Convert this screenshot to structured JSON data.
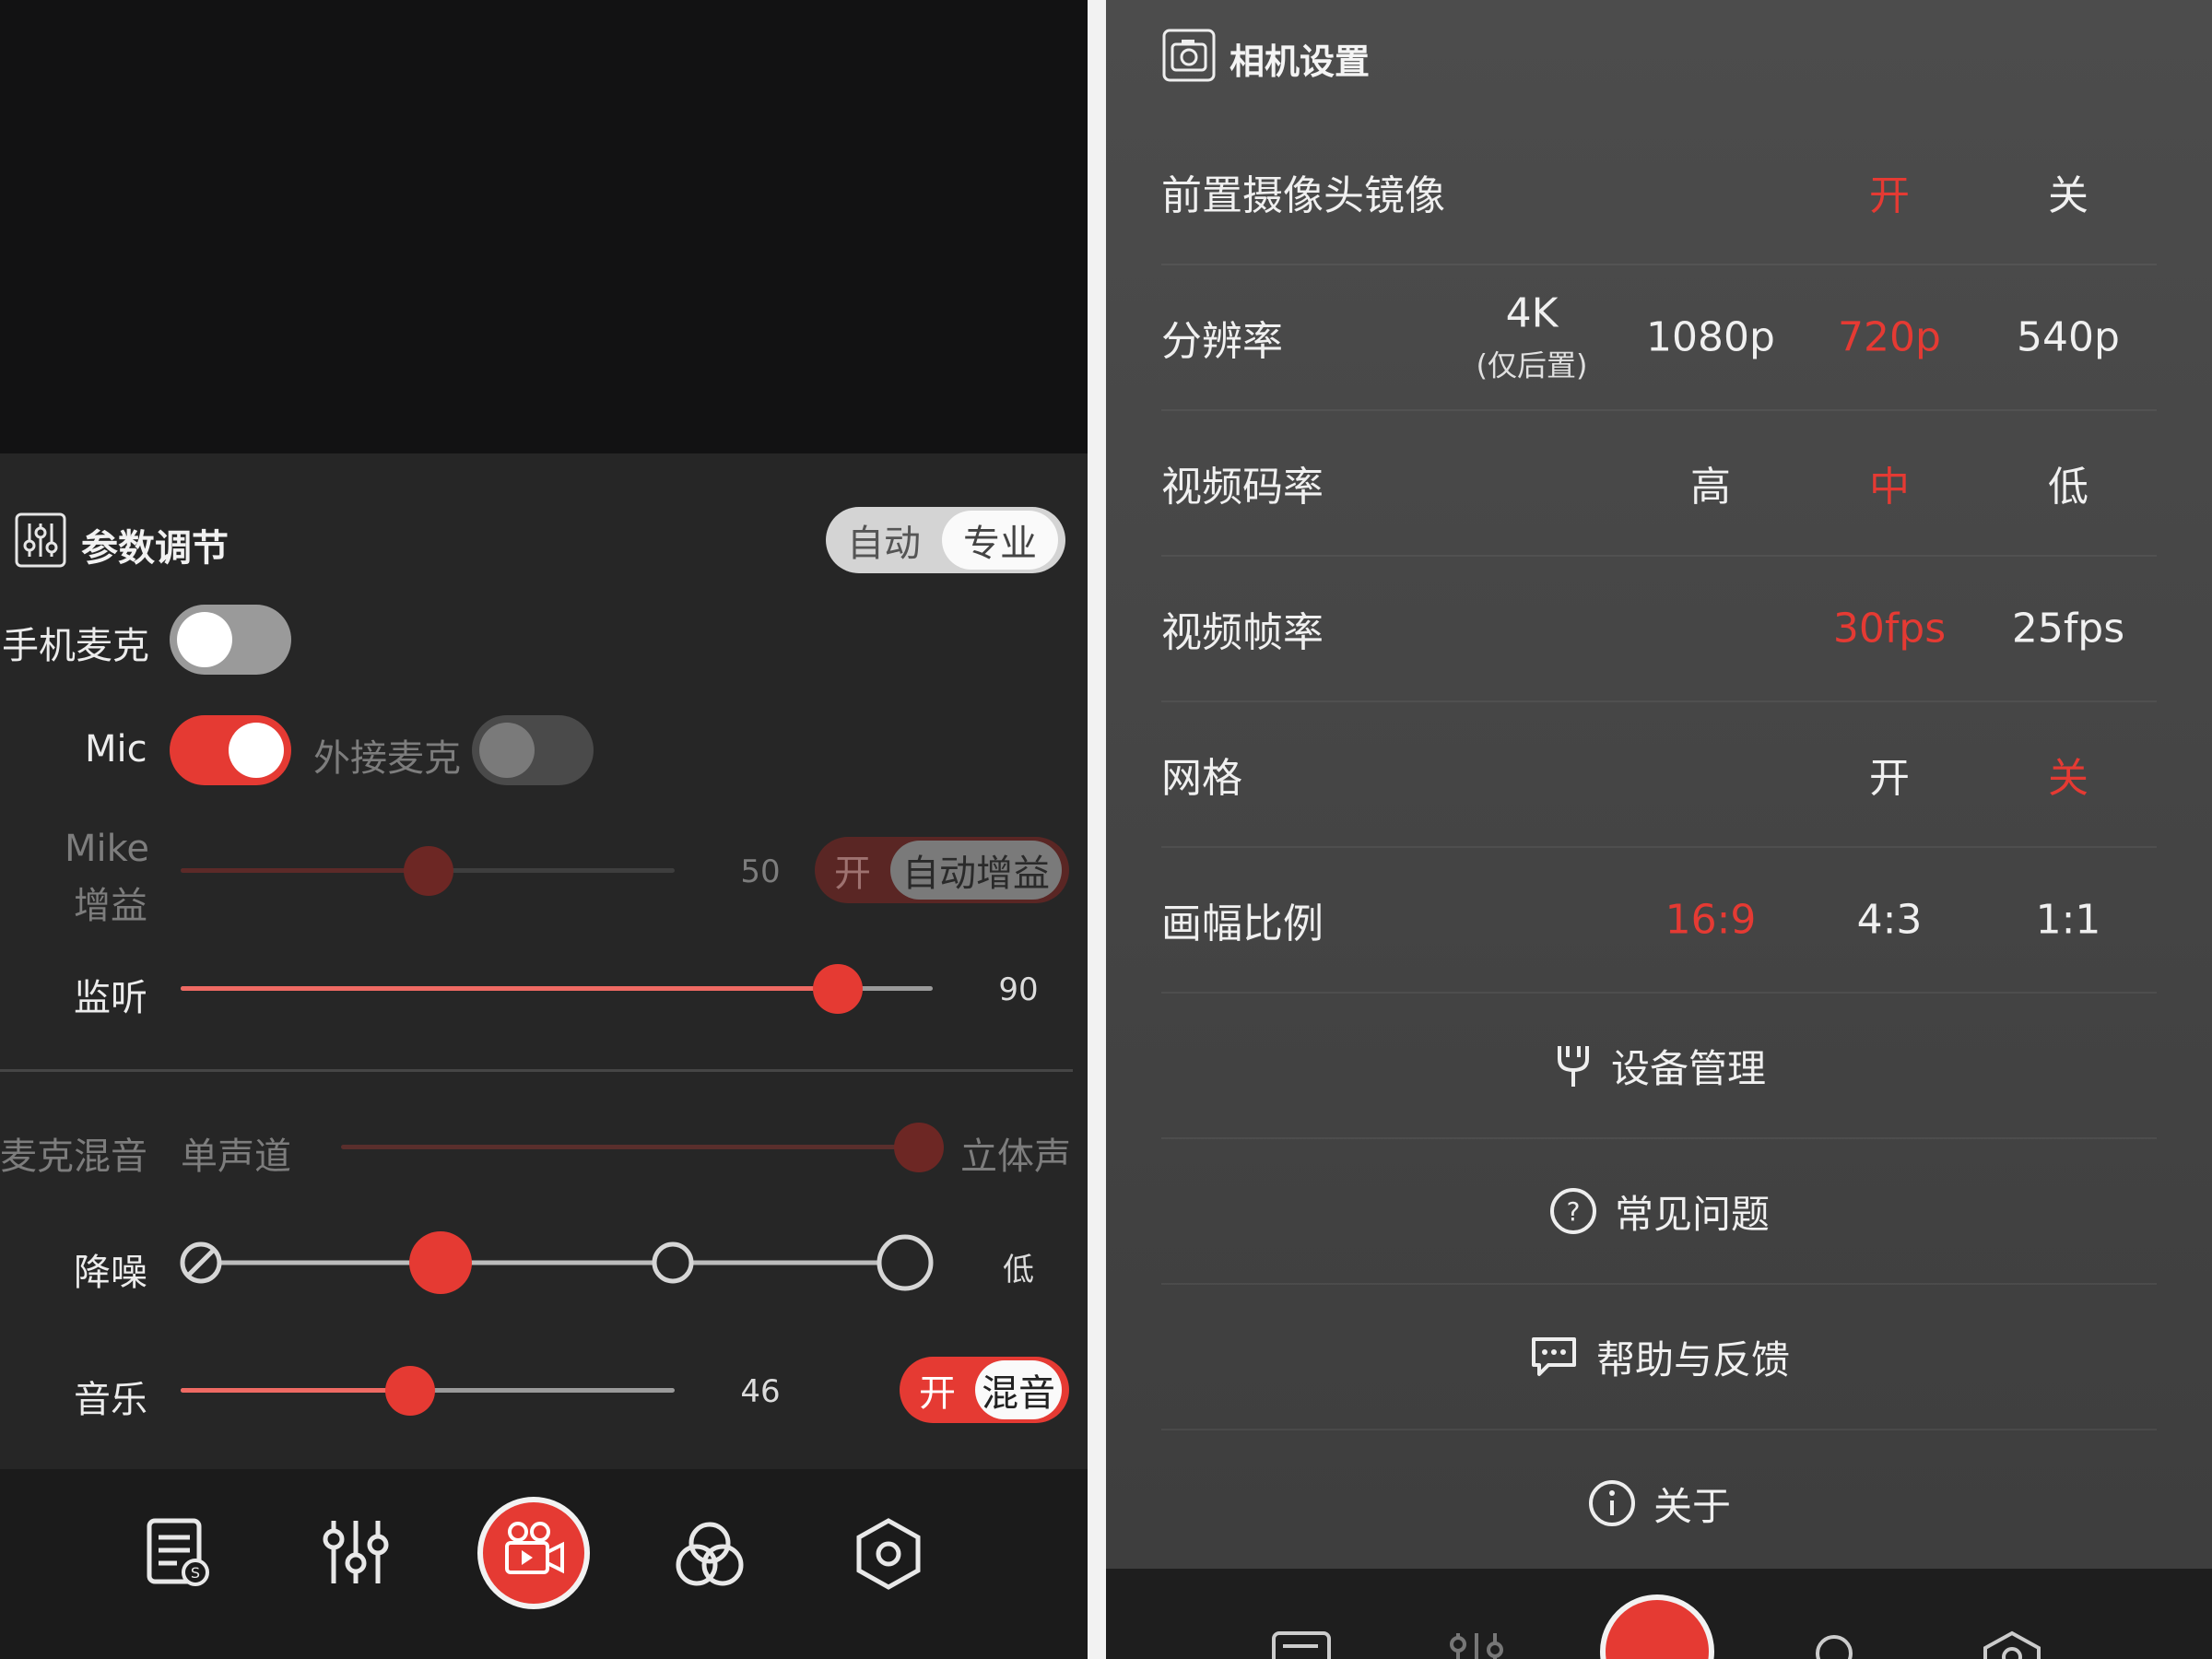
{
  "left": {
    "header": {
      "title": "参数调节",
      "mode_options": [
        "自动",
        "专业"
      ],
      "mode_selected": "专业"
    },
    "phone_mic": {
      "label": "手机麦克",
      "on": false
    },
    "mic": {
      "label": "Mic",
      "on": true,
      "external_label": "外接麦克",
      "external_on": false
    },
    "mike_gain": {
      "label_line1": "Mike",
      "label_line2": "增益",
      "value": "50",
      "level": 0.5,
      "switch_on_label": "开",
      "switch_off_label": "自动增益"
    },
    "monitor": {
      "label": "监听",
      "value": "90",
      "level": 0.9
    },
    "mic_mix": {
      "label": "麦克混音",
      "left_label": "单声道",
      "right_label": "立体声",
      "level": 1.0
    },
    "denoise": {
      "label": "降噪",
      "value": "低",
      "steps": 4,
      "selected_step": 1
    },
    "music": {
      "label": "音乐",
      "value": "46",
      "level": 0.46,
      "switch_on_label": "开",
      "switch_off_label": "混音"
    },
    "nav": [
      "script-icon",
      "sliders-icon",
      "record-icon",
      "filter-icon",
      "settings-icon"
    ]
  },
  "right": {
    "title": "相机设置",
    "rows": [
      {
        "label": "前置摄像头镜像",
        "options": [
          {
            "text": "开",
            "selected": true
          },
          {
            "text": "关",
            "selected": false
          }
        ]
      },
      {
        "label": "分辨率",
        "options": [
          {
            "text": "4K",
            "sub": "(仅后置)",
            "selected": false
          },
          {
            "text": "1080p",
            "selected": false
          },
          {
            "text": "720p",
            "selected": true
          },
          {
            "text": "540p",
            "selected": false
          }
        ]
      },
      {
        "label": "视频码率",
        "options": [
          {
            "text": "高",
            "selected": false
          },
          {
            "text": "中",
            "selected": true
          },
          {
            "text": "低",
            "selected": false
          }
        ]
      },
      {
        "label": "视频帧率",
        "options": [
          {
            "text": "30fps",
            "selected": true
          },
          {
            "text": "25fps",
            "selected": false
          }
        ]
      },
      {
        "label": "网格",
        "options": [
          {
            "text": "开",
            "selected": false
          },
          {
            "text": "关",
            "selected": true
          }
        ]
      },
      {
        "label": "画幅比例",
        "options": [
          {
            "text": "16:9",
            "selected": true
          },
          {
            "text": "4:3",
            "selected": false
          },
          {
            "text": "1:1",
            "selected": false
          }
        ]
      }
    ],
    "menu": [
      {
        "icon": "wrench-icon",
        "label": "设备管理"
      },
      {
        "icon": "question-icon",
        "label": "常见问题"
      },
      {
        "icon": "feedback-icon",
        "label": "帮助与反馈"
      },
      {
        "icon": "info-icon",
        "label": "关于"
      }
    ]
  },
  "colors": {
    "accent": "#e53a33",
    "panel": "#262626",
    "settings_bg": "#464646"
  }
}
